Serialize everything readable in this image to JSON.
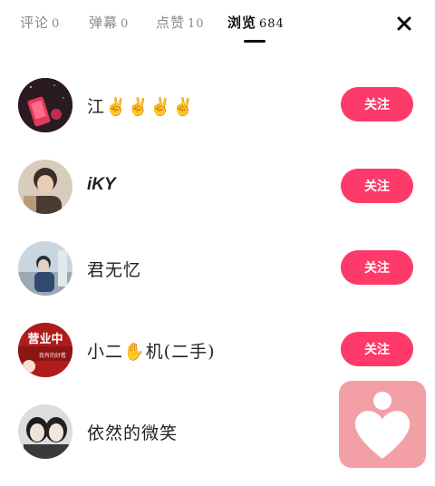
{
  "tabs": [
    {
      "label": "评论",
      "count": "0"
    },
    {
      "label": "弹幕",
      "count": "0"
    },
    {
      "label": "点赞",
      "count": "10"
    },
    {
      "label": "浏览",
      "count": "684"
    }
  ],
  "viewers": [
    {
      "name": "江✌✌✌✌",
      "follow_label": "关注"
    },
    {
      "name": "iKY",
      "follow_label": "关注"
    },
    {
      "name": "君无忆",
      "follow_label": "关注"
    },
    {
      "name": "小二✋机(二手)",
      "follow_label": "关注"
    },
    {
      "name": "依然的微笑",
      "follow_label": ""
    }
  ],
  "avatar4_text": {
    "top": "营业中",
    "bottom": "我有的好看"
  },
  "icons": {
    "close": "close-icon",
    "fab": "heart-icon"
  },
  "colors": {
    "accent": "#fd3a69",
    "fab": "#f2a0a6"
  }
}
